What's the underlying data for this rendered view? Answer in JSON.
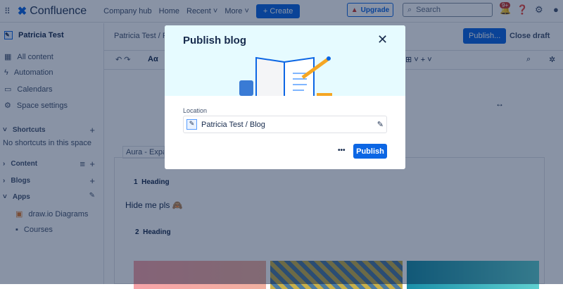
{
  "nav": {
    "product": "Confluence",
    "links": [
      "Company hub",
      "Home",
      "Recent",
      "More"
    ],
    "create": "Create",
    "upgrade": "Upgrade",
    "search_placeholder": "Search",
    "notifications": "9+"
  },
  "sidebar": {
    "space": "Patricia Test",
    "items": [
      "All content",
      "Automation",
      "Calendars",
      "Space settings"
    ],
    "shortcuts": "Shortcuts",
    "no_shortcuts": "No shortcuts in this space",
    "content": "Content",
    "blogs": "Blogs",
    "apps": "Apps",
    "app_items": [
      "draw.io Diagrams",
      "Courses"
    ]
  },
  "editor": {
    "breadcrumb": "Patricia Test  /  F",
    "publish": "Publish...",
    "close_draft": "Close draft",
    "text_style": "Aα",
    "macro": "Aura - Expan",
    "heading1": "Heading",
    "heading2": "Heading",
    "num1": "1",
    "num2": "2",
    "body": "Hide me pls 🙈"
  },
  "modal": {
    "title": "Publish blog",
    "location_label": "Location",
    "location_value": "Patricia Test / Blog",
    "publish": "Publish",
    "more": "•••"
  }
}
